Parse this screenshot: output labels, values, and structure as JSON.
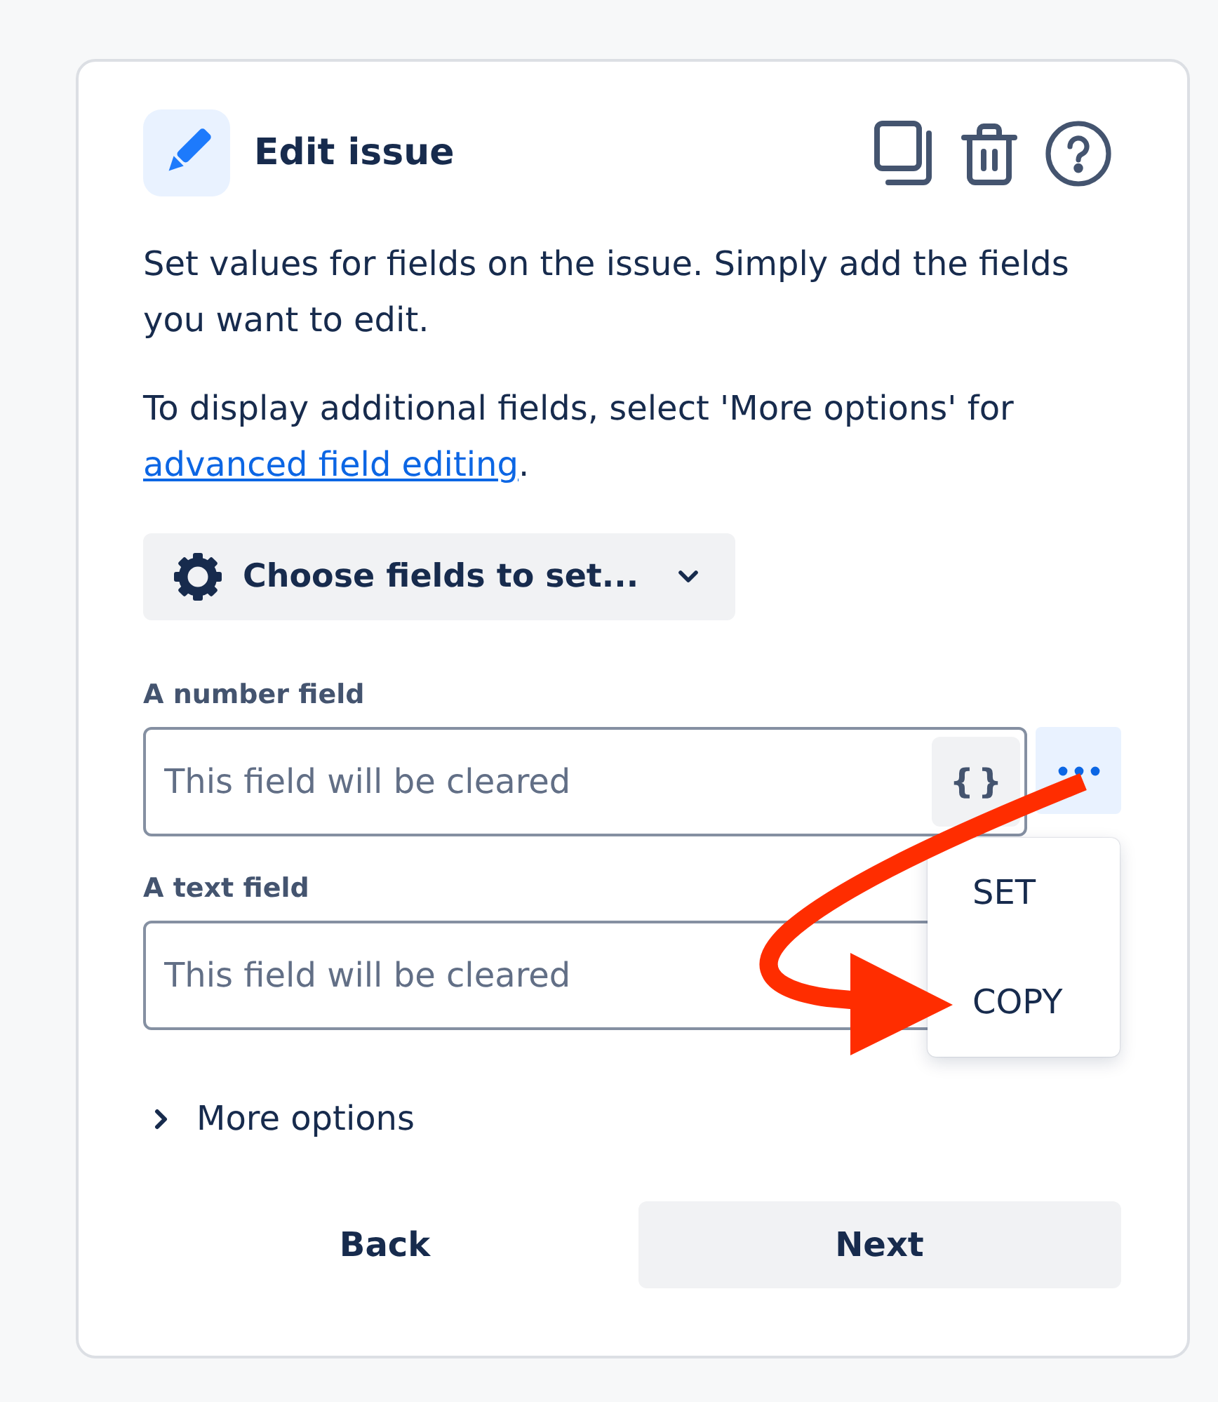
{
  "header": {
    "title": "Edit issue"
  },
  "description": {
    "intro": "Set values for fields on the issue. Simply add the fields you want to edit.",
    "note": "To display additional fields, select 'More options' for",
    "link": "advanced field editing",
    "note_end": "."
  },
  "field_picker": {
    "label": "Choose fields to set..."
  },
  "fields": [
    {
      "label": "A number field",
      "placeholder": "This field will be cleared",
      "format_button": "{}",
      "menu": {
        "open": true,
        "items": [
          {
            "label": "SET"
          },
          {
            "label": "COPY"
          }
        ]
      }
    },
    {
      "label": "A text field",
      "placeholder": "This field will be cleared"
    }
  ],
  "more_options": {
    "label": "More options",
    "expanded": false
  },
  "footer": {
    "buttons": [
      {
        "label": "Back",
        "kind": "subtle"
      },
      {
        "label": "Next",
        "kind": "default"
      }
    ]
  }
}
